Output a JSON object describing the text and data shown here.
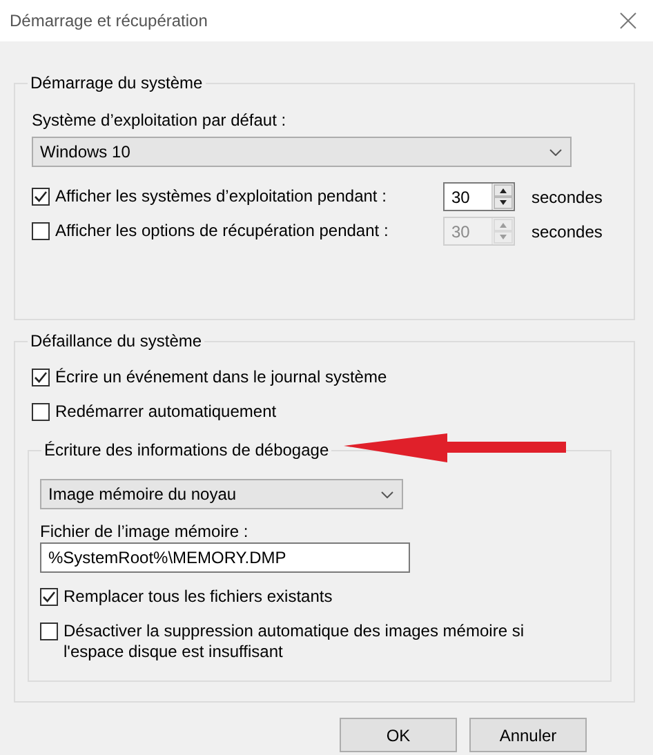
{
  "window": {
    "title": "Démarrage et récupération"
  },
  "startup": {
    "legend": "Démarrage du système",
    "default_os_label": "Système d’exploitation par défaut :",
    "default_os": "Windows 10",
    "rows": [
      {
        "label": "Afficher les systèmes d’exploitation pendant :",
        "checked": true,
        "value": "30",
        "disabled": false,
        "unit": "secondes"
      },
      {
        "label": "Afficher les options de récupération pendant :",
        "checked": false,
        "value": "30",
        "disabled": true,
        "unit": "secondes"
      }
    ]
  },
  "failure": {
    "legend": "Défaillance du système",
    "options": [
      {
        "label": "Écrire un événement dans le journal système",
        "checked": true
      },
      {
        "label": "Redémarrer automatiquement",
        "checked": false
      }
    ],
    "debug": {
      "legend": "Écriture des informations de débogage",
      "dump_type": "Image mémoire du noyau",
      "file_label": "Fichier de l’image mémoire :",
      "file": "%SystemRoot%\\MEMORY.DMP",
      "options": [
        {
          "label": "Remplacer tous les fichiers existants",
          "checked": true
        },
        {
          "label": "Désactiver la suppression automatique des images mémoire si l'espace disque est insuffisant",
          "checked": false
        }
      ]
    }
  },
  "buttons": [
    "OK",
    "Annuler"
  ]
}
